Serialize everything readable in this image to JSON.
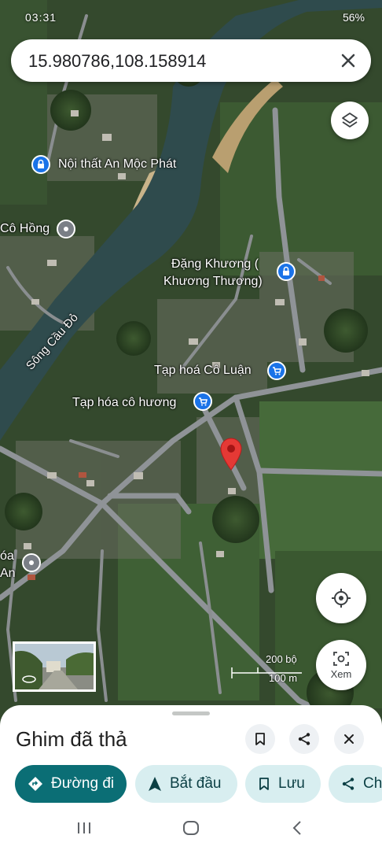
{
  "status_bar": {
    "left_text": "03:31",
    "right_text": "56%"
  },
  "search": {
    "value": "15.980786,108.158914",
    "close_icon": "close-icon"
  },
  "map": {
    "labels": [
      {
        "text": "Nội thất An Mộc Phát",
        "kind": "shop"
      },
      {
        "text": "Cô Hồng",
        "kind": "place"
      },
      {
        "text": "Đặng Khương (",
        "kind": "label"
      },
      {
        "text": "Khương Thương)",
        "kind": "label"
      },
      {
        "text": "Sông Cầu Đỏ",
        "kind": "river"
      },
      {
        "text": "Tạp hoá Cô Luận",
        "kind": "grocery"
      },
      {
        "text": "Tạp hóa cô hương",
        "kind": "grocery"
      },
      {
        "text": "óa",
        "kind": "place"
      },
      {
        "text": "An",
        "kind": "place"
      }
    ],
    "scale": {
      "top": "200 bộ",
      "bottom": "100 m"
    },
    "view_button": "Xem",
    "colors": {
      "river": "#2f4b4d",
      "road": "#8f9397",
      "pin": "#e53935",
      "poi_blue": "#1a73e8",
      "poi_gray": "#7a7f86"
    }
  },
  "sheet": {
    "title": "Ghim đã thả",
    "actions": [
      {
        "label": "Đường đi",
        "icon": "directions-icon",
        "primary": true
      },
      {
        "label": "Bắt đầu",
        "icon": "navigation-arrow-icon",
        "primary": false
      },
      {
        "label": "Lưu",
        "icon": "bookmark-icon",
        "primary": false
      },
      {
        "label": "Ch",
        "icon": "share-icon",
        "primary": false
      }
    ],
    "top_buttons": [
      "bookmark-icon",
      "share-icon",
      "close-icon"
    ]
  },
  "nav_bar": [
    "recent-apps-icon",
    "home-icon",
    "back-icon"
  ]
}
